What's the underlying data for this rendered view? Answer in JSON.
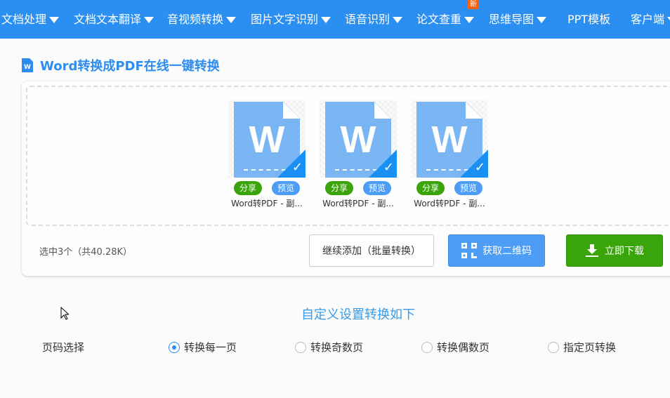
{
  "nav": {
    "items": [
      {
        "label": "文档处理",
        "dropdown": true
      },
      {
        "label": "文档文本翻译",
        "dropdown": true
      },
      {
        "label": "音视频转换",
        "dropdown": true
      },
      {
        "label": "图片文字识别",
        "dropdown": true
      },
      {
        "label": "语音识别",
        "dropdown": true
      },
      {
        "label": "论文查重",
        "dropdown": true
      },
      {
        "label": "思维导图",
        "dropdown": true
      },
      {
        "label": "PPT模板",
        "dropdown": false
      },
      {
        "label": "客户端",
        "dropdown": true
      }
    ],
    "new_badge": "新"
  },
  "page": {
    "title": "Word转换成PDF在线一键转换",
    "title_icon": "W"
  },
  "files": [
    {
      "name": "Word转PDF - 副...",
      "share": "分享",
      "preview": "预览",
      "icon_letter": "W",
      "selected": true
    },
    {
      "name": "Word转PDF - 副...",
      "share": "分享",
      "preview": "预览",
      "icon_letter": "W",
      "selected": true
    },
    {
      "name": "Word转PDF - 副...",
      "share": "分享",
      "preview": "预览",
      "icon_letter": "W",
      "selected": true
    }
  ],
  "summary": "选中3个（共40.28K）",
  "actions": {
    "add_more": "继续添加（批量转换）",
    "qr": "获取二维码",
    "download": "立即下载"
  },
  "settings": {
    "heading": "自定义设置转换如下",
    "label": "页码选择",
    "options": [
      {
        "label": "转换每一页",
        "checked": true
      },
      {
        "label": "转换奇数页",
        "checked": false
      },
      {
        "label": "转换偶数页",
        "checked": false
      },
      {
        "label": "指定页转换",
        "checked": false
      }
    ]
  },
  "colors": {
    "nav": "#2a8ff0",
    "accent": "#2d8cf0",
    "share": "#3aa50b",
    "preview": "#4d9df5",
    "download": "#3aa50b",
    "badge": "#f5600a"
  }
}
